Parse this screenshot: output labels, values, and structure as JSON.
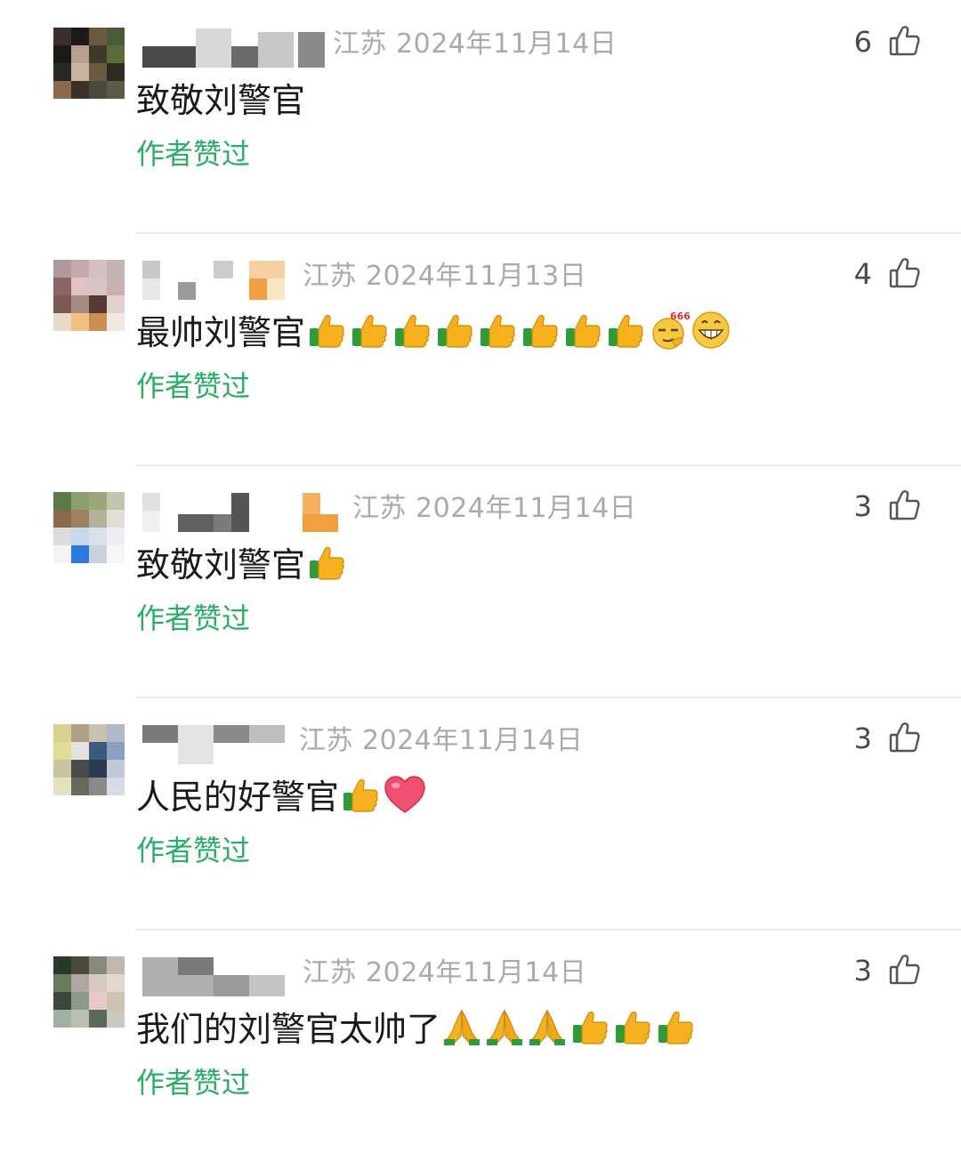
{
  "comments": [
    {
      "meta": "江苏 2024年11月14日",
      "text": "致敬刘警官",
      "emojis": [],
      "author_liked": "作者赞过",
      "likes": "6",
      "avatar": [
        "#3a2f2a",
        "#1e1a17",
        "#6b5a3e",
        "#4a5a3a",
        "#1c1a16",
        "#b6a08e",
        "#3c3a2a",
        "#5a6a3a",
        "#2a2824",
        "#c9b4a0",
        "#6a5a44",
        "#2e2c22",
        "#8a6a4a",
        "#3a3028",
        "#4a4a3a",
        "#5c5a44"
      ]
    },
    {
      "meta": "江苏 2024年11月13日",
      "text": "最帅刘警官",
      "emojis": [
        "thumbs-up",
        "thumbs-up",
        "thumbs-up",
        "thumbs-up",
        "thumbs-up",
        "thumbs-up",
        "thumbs-up",
        "thumbs-up",
        "666",
        "grin"
      ],
      "author_liked": "作者赞过",
      "likes": "4",
      "avatar": [
        "#b0989a",
        "#c4a8aa",
        "#d4c0c0",
        "#c2b4b4",
        "#8a6466",
        "#e2c2c0",
        "#d8c4c4",
        "#c9b2ae",
        "#7a5a54",
        "#a88a84",
        "#5a3a34",
        "#e0d0d0",
        "#e8d8c8",
        "#f0c080",
        "#c89050",
        "#f0e8e0"
      ]
    },
    {
      "meta": "江苏 2024年11月14日",
      "text": "致敬刘警官",
      "emojis": [
        "thumbs-up"
      ],
      "author_liked": "作者赞过",
      "likes": "3",
      "avatar": [
        "#5a7a4a",
        "#8aa070",
        "#9aa878",
        "#c2c6b0",
        "#8a6a4a",
        "#9c8060",
        "#b4b09c",
        "#e0ded6",
        "#dcdce0",
        "#c8d8ec",
        "#d8e0ec",
        "#eeeef2",
        "#f2f4f8",
        "#2a7ae0",
        "#c8d0e0",
        "#f6f6f8"
      ]
    },
    {
      "meta": "江苏 2024年11月14日",
      "text": "人民的好警官",
      "emojis": [
        "thumbs-up",
        "heart"
      ],
      "author_liked": "作者赞过",
      "likes": "3",
      "avatar": [
        "#d8d090",
        "#b0a088",
        "#c8c0b0",
        "#b0b8c8",
        "#e0dc98",
        "#e4e2dc",
        "#3a5a80",
        "#8aa0c0",
        "#c8c4a0",
        "#4a4a4a",
        "#2a3a50",
        "#c0c8d8",
        "#e4e0c0",
        "#6a6a5a",
        "#8a8a8a",
        "#d8dce4"
      ]
    },
    {
      "meta": "江苏 2024年11月14日",
      "text": "我们的刘警官太帅了",
      "emojis": [
        "pray",
        "pray",
        "pray",
        "thumbs-up",
        "thumbs-up",
        "thumbs-up"
      ],
      "author_liked": "作者赞过",
      "likes": "3",
      "avatar": [
        "#2a3a2a",
        "#4a4a3a",
        "#8a8a7a",
        "#c0b8b0",
        "#6a7a5a",
        "#b0a8a0",
        "#d8c8c0",
        "#e0d8d0",
        "#3a4a3a",
        "#8a9a8a",
        "#e8c8c8",
        "#d0c0b0",
        "#a0b0a0",
        "#b8c0b0",
        "#5a6a5a",
        "#c8c8c0"
      ]
    }
  ],
  "colors": {
    "author_liked": "#2aae67",
    "meta": "#aaaaaa",
    "divider": "#ececec"
  },
  "icons": {
    "like": "thumbs-up-outline-icon"
  }
}
